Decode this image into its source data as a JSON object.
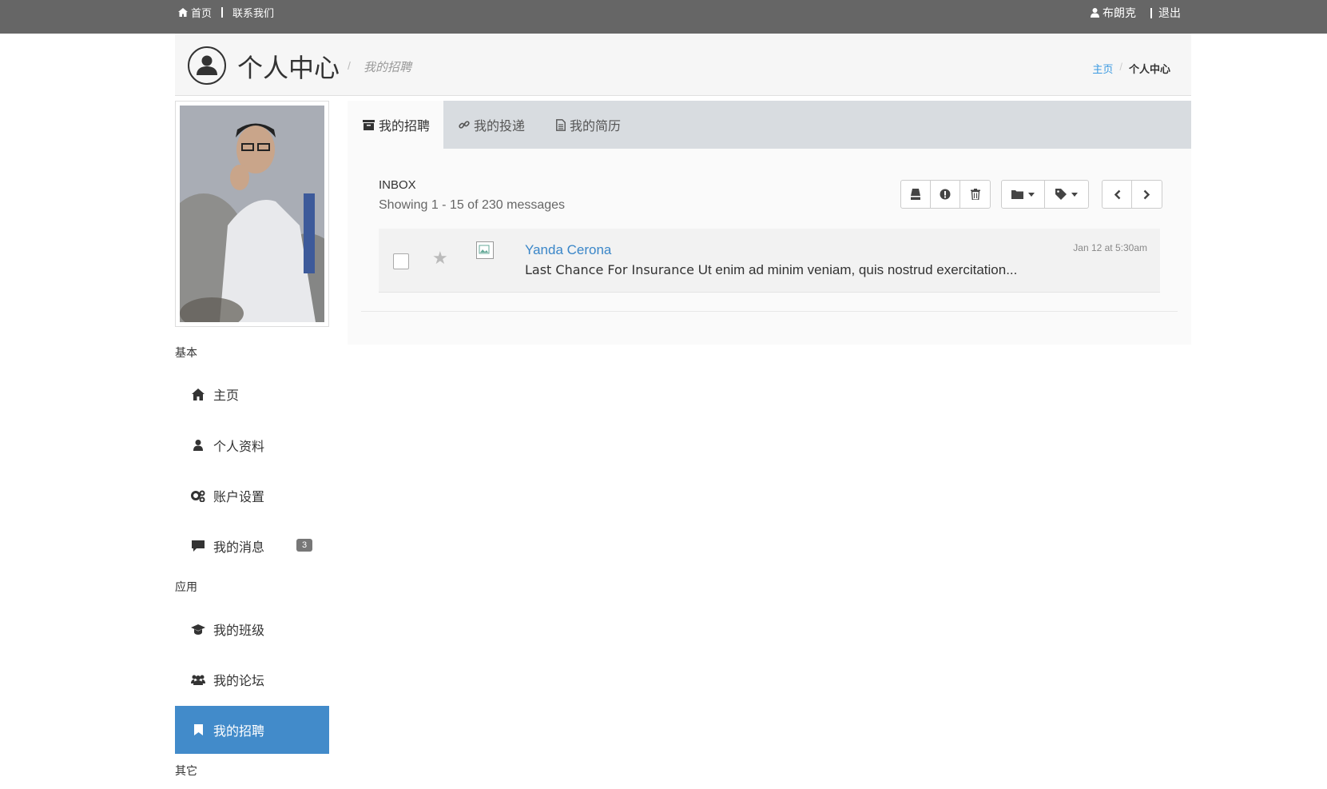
{
  "topbar": {
    "home_link": "首页",
    "contact_link": "联系我们",
    "user_name": "布朗克",
    "logout_link": "退出"
  },
  "header": {
    "title": "个人中心",
    "subtitle": "我的招聘",
    "breadcrumb": {
      "home": "主页",
      "current": "个人中心"
    }
  },
  "sidebar": {
    "section_basic": "基本",
    "section_apps": "应用",
    "section_other": "其它",
    "items": [
      {
        "label": "主页",
        "icon": "home-icon"
      },
      {
        "label": "个人资料",
        "icon": "user-icon"
      },
      {
        "label": "账户设置",
        "icon": "gears-icon"
      },
      {
        "label": "我的消息",
        "icon": "comment-icon",
        "badge": "3"
      },
      {
        "label": "我的班级",
        "icon": "graduation-cap-icon"
      },
      {
        "label": "我的论坛",
        "icon": "users-icon"
      },
      {
        "label": "我的招聘",
        "icon": "bookmark-icon",
        "active": true
      }
    ]
  },
  "main": {
    "tabs": [
      {
        "label": "我的招聘",
        "icon": "archive-icon",
        "active": true
      },
      {
        "label": "我的投递",
        "icon": "link-icon"
      },
      {
        "label": "我的简历",
        "icon": "file-icon"
      }
    ],
    "inbox_title": "INBOX",
    "inbox_count": "Showing 1 - 15 of 230 messages",
    "messages": [
      {
        "sender": "Yanda Cerona",
        "subject": "Last Chance For Insurance",
        "preview": " Ut enim ad minim veniam, quis nostrud exercitation...",
        "time": "Jan 12 at 5:30am",
        "starred": false
      }
    ]
  },
  "colors": {
    "topbar": "#666666",
    "accent": "#428bca",
    "link": "#3b9ae1"
  }
}
